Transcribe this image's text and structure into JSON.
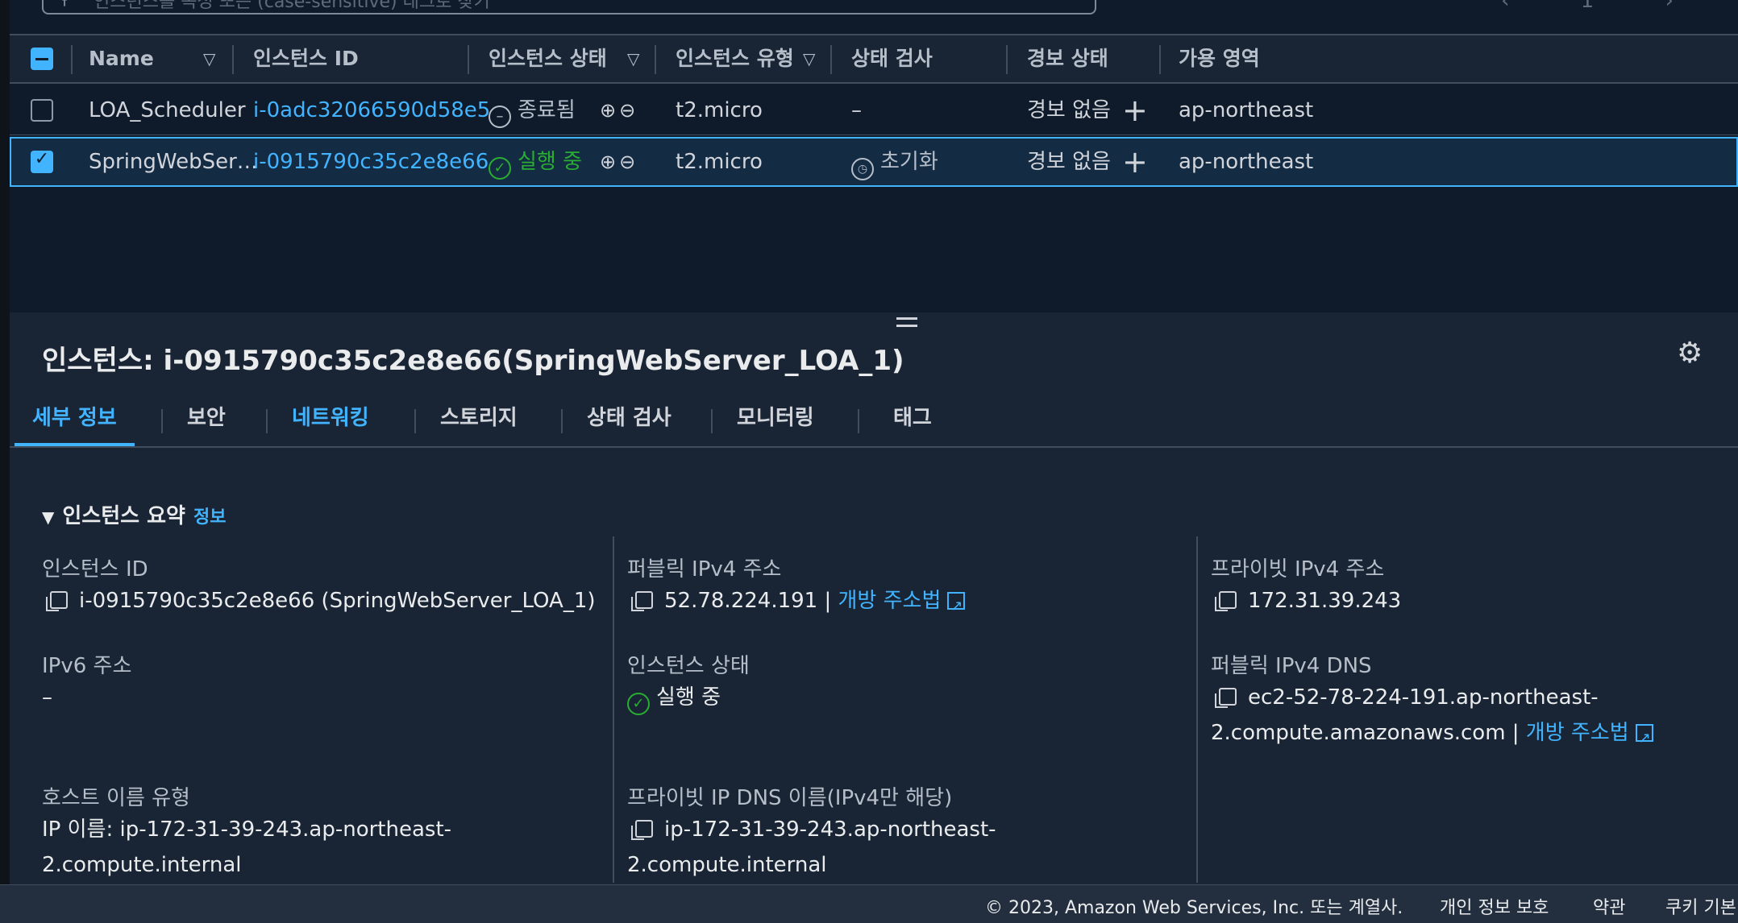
{
  "search": {
    "placeholder": "인스턴스를 속성 또는 (case-sensitive) 태그로 찾기"
  },
  "table": {
    "headers": {
      "name": "Name",
      "instance_id": "인스턴스 ID",
      "instance_state": "인스턴스 상태",
      "instance_type": "인스턴스 유형",
      "status_check": "상태 검사",
      "alarm_status": "경보 상태",
      "az": "가용 영역"
    },
    "rows": [
      {
        "name": "LOA_Scheduler",
        "instance_id": "i-0adc32066590d58e5",
        "state": "종료됨",
        "type": "t2.micro",
        "status_check": "–",
        "alarm": "경보 없음",
        "az": "ap-northeast",
        "selected": false
      },
      {
        "name": "SpringWebSer…",
        "instance_id": "i-0915790c35c2e8e66",
        "state": "실행 중",
        "type": "t2.micro",
        "status_check": "초기화",
        "alarm": "경보 없음",
        "az": "ap-northeast",
        "selected": true
      }
    ]
  },
  "details": {
    "title": "인스턴스: i-0915790c35c2e8e66(SpringWebServer_LOA_1)",
    "tabs": [
      "세부 정보",
      "보안",
      "네트워킹",
      "스토리지",
      "상태 검사",
      "모니터링",
      "태그"
    ],
    "section": {
      "title": "인스턴스 요약",
      "info": "정보"
    },
    "instance_id": {
      "label": "인스턴스 ID",
      "value": "i-0915790c35c2e8e66 (SpringWebServer_LOA_1)"
    },
    "public_ipv4": {
      "label": "퍼블릭 IPv4 주소",
      "value": "52.78.224.191 |",
      "link": "개방 주소법"
    },
    "private_ipv4": {
      "label": "프라이빗 IPv4 주소",
      "value": "172.31.39.243"
    },
    "ipv6": {
      "label": "IPv6 주소",
      "value": "–"
    },
    "state": {
      "label": "인스턴스 상태",
      "value": "실행 중"
    },
    "public_dns": {
      "label": "퍼블릭 IPv4 DNS",
      "value_line1": "ec2-52-78-224-191.ap-northeast-",
      "value_line2": "2.compute.amazonaws.com |",
      "link": "개방 주소법"
    },
    "hostname_type": {
      "label": "호스트 이름 유형",
      "value_line1": "IP 이름: ip-172-31-39-243.ap-northeast-",
      "value_line2": "2.compute.internal"
    },
    "private_dns": {
      "label": "프라이빗 IP DNS 이름(IPv4만 해당)",
      "value_line1": "ip-172-31-39-243.ap-northeast-",
      "value_line2": "2.compute.internal"
    }
  },
  "footer": {
    "copyright": "© 2023, Amazon Web Services, Inc. 또는 계열사.",
    "privacy": "개인 정보 보호",
    "terms": "약관",
    "cookies": "쿠키 기본"
  },
  "colors": {
    "accent": "#42b4ff",
    "success": "#29ad32",
    "bg": "#0f1b2a",
    "panel": "#192534"
  }
}
